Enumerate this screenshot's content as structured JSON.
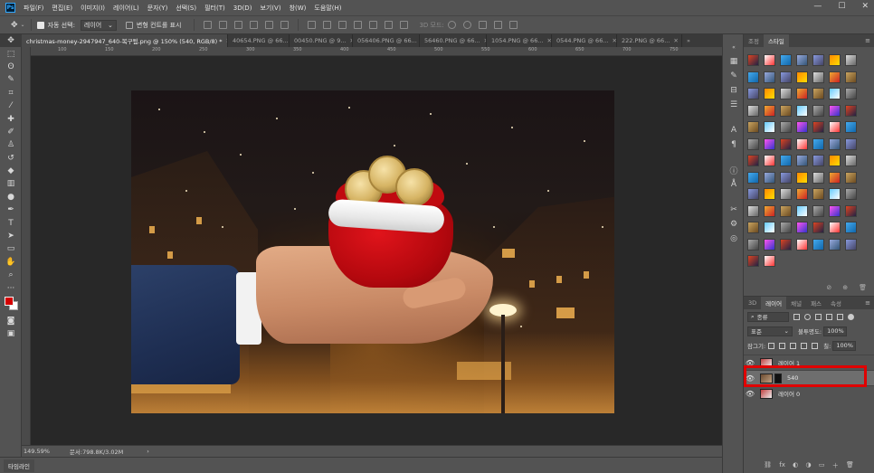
{
  "menubar": {
    "logo": "Ps",
    "items": [
      "파일(F)",
      "편집(E)",
      "이미지(I)",
      "레이어(L)",
      "문자(Y)",
      "선택(S)",
      "필터(T)",
      "3D(D)",
      "보기(V)",
      "창(W)",
      "도움말(H)"
    ],
    "window_controls": {
      "minimize": "—",
      "maximize": "☐",
      "close": "✕"
    }
  },
  "options": {
    "auto_select_label": "자동 선택:",
    "auto_select_value": "레이어",
    "transform_label": "변형 컨트롤 표시",
    "mode_3d_label": "3D 모드:"
  },
  "tabs": [
    {
      "label": "christmas-money-2947947_640-복구됨.png @ 150% (540, RGB/8) *",
      "active": true
    },
    {
      "label": "40654.PNG @ 66...",
      "active": false
    },
    {
      "label": "00450.PNG @ 9...",
      "active": false
    },
    {
      "label": "056406.PNG @ 66...",
      "active": false
    },
    {
      "label": "56460.PNG @ 66...",
      "active": false
    },
    {
      "label": "1054.PNG @ 66...",
      "active": false
    },
    {
      "label": "0544.PNG @ 66...",
      "active": false
    },
    {
      "label": "222.PNG @ 66...",
      "active": false
    }
  ],
  "ruler": {
    "marks": [
      "100",
      "150",
      "200",
      "250",
      "300",
      "350",
      "400",
      "450",
      "500",
      "550",
      "600",
      "650",
      "700",
      "750"
    ]
  },
  "status": {
    "zoom": "149.59%",
    "doc_info": "문서:798.8K/3.02M",
    "arrow": "›"
  },
  "timeline_label": "타임라인",
  "styles_panel": {
    "tabs": [
      {
        "label": "조정",
        "active": false
      },
      {
        "label": "스타일",
        "active": true
      }
    ],
    "footer": [
      "⊘",
      "⊕",
      "🗑"
    ]
  },
  "layers_panel": {
    "tabs": [
      {
        "label": "3D",
        "active": false
      },
      {
        "label": "레이어",
        "active": true
      },
      {
        "label": "채널",
        "active": false
      },
      {
        "label": "패스",
        "active": false
      },
      {
        "label": "속성",
        "active": false
      }
    ],
    "filter_label": "종류",
    "blend_mode": "표준",
    "opacity_label": "불투명도:",
    "opacity_value": "100%",
    "lock_label": "잠그기:",
    "fill_label": "칠:",
    "fill_value": "100%",
    "layers": [
      {
        "name": "레이어 1",
        "selected": false
      },
      {
        "name": "540",
        "selected": true
      },
      {
        "name": "레이어 0",
        "selected": false
      }
    ],
    "footer": [
      "⛓",
      "fx",
      "◐",
      "◑",
      "▭",
      "＋",
      "🗑"
    ]
  },
  "colors": {
    "foreground": "#d40000",
    "background": "#ffffff",
    "selection_highlight": "#e00000"
  },
  "tool_icons": [
    "move-tool-icon",
    "marquee-tool-icon",
    "lasso-tool-icon",
    "quick-select-tool-icon",
    "crop-tool-icon",
    "eyedropper-tool-icon",
    "healing-tool-icon",
    "brush-tool-icon",
    "clone-stamp-tool-icon",
    "history-brush-tool-icon",
    "eraser-tool-icon",
    "gradient-tool-icon",
    "dodge-tool-icon",
    "pen-tool-icon",
    "type-tool-icon",
    "path-select-tool-icon",
    "shape-tool-icon",
    "hand-tool-icon",
    "zoom-tool-icon",
    "more-tools-icon"
  ]
}
